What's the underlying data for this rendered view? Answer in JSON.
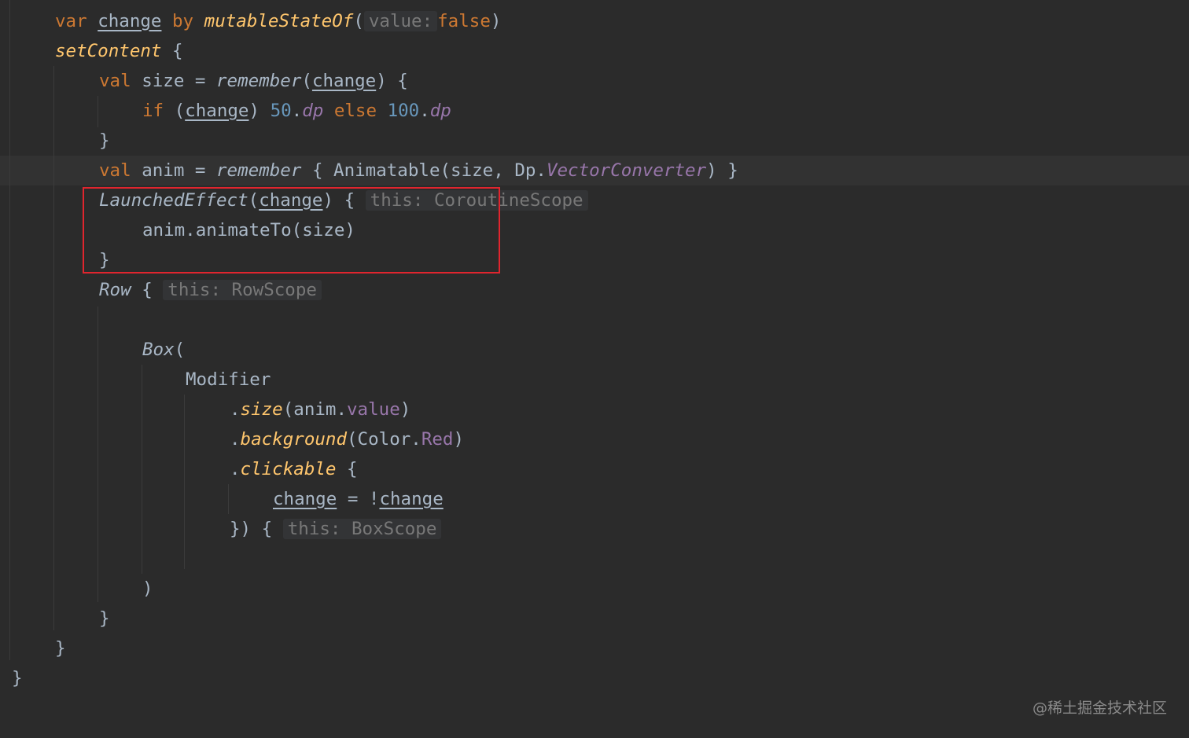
{
  "editor": {
    "lines": {
      "l1": {
        "kw_var": "var",
        "var_change": "change",
        "kw_by": "by",
        "fn": "mutableStateOf",
        "paren_open": "(",
        "hint": "value:",
        "kw_false": "false",
        "paren_close": ")"
      },
      "l2": {
        "fn": "setContent",
        "brace": "{"
      },
      "l3": {
        "kw_val": "val",
        "text1": "size =",
        "fn": "remember",
        "paren_open": "(",
        "var_change": "change",
        "text2": ") {"
      },
      "l4": {
        "kw_if": "if",
        "paren_open": "(",
        "var_change": "change",
        "paren_close": ")",
        "num1": "50",
        "dot1": ".",
        "unit1": "dp",
        "kw_else": "else",
        "num2": "100",
        "dot2": ".",
        "unit2": "dp"
      },
      "l5": {
        "brace": "}"
      },
      "l6": {
        "kw_val": "val",
        "text1": "anim =",
        "fn": "remember",
        "text2": "{ Animatable(size, Dp.",
        "prop": "VectorConverter",
        "text3": ") }"
      },
      "l7": {
        "fn": "LaunchedEffect",
        "paren_open": "(",
        "var_change": "change",
        "text2": ") {",
        "hint": "this: CoroutineScope"
      },
      "l8": {
        "text": "anim.animateTo(size)"
      },
      "l9": {
        "brace": "}"
      },
      "l10": {
        "fn": "Row",
        "brace": "{",
        "hint": "this: RowScope"
      },
      "l12": {
        "fn": "Box",
        "paren_open": "("
      },
      "l13": {
        "text": "Modifier"
      },
      "l14": {
        "dot": ".",
        "fn": "size",
        "text1": "(anim.",
        "prop": "value",
        "text2": ")"
      },
      "l15": {
        "dot": ".",
        "fn": "background",
        "text1": "(Color.",
        "prop": "Red",
        "text2": ")"
      },
      "l16": {
        "dot": ".",
        "fn": "clickable",
        "brace": "{"
      },
      "l17": {
        "var_change1": "change",
        "text": "= !",
        "var_change2": "change"
      },
      "l18": {
        "text": "}) {",
        "hint": "this: BoxScope"
      },
      "l20": {
        "text": ")"
      },
      "l21": {
        "brace": "}"
      },
      "l22": {
        "brace": "}"
      },
      "l23": {
        "brace": "}"
      }
    }
  },
  "watermark": {
    "text": "@稀土掘金技术社区"
  },
  "colors": {
    "background": "#2b2b2b",
    "keyword": "#cc7832",
    "function": "#ffc66d",
    "number": "#6897bb",
    "property": "#9876aa",
    "text": "#a9b7c6",
    "hint": "#787878",
    "highlight_box": "#e0252e"
  }
}
